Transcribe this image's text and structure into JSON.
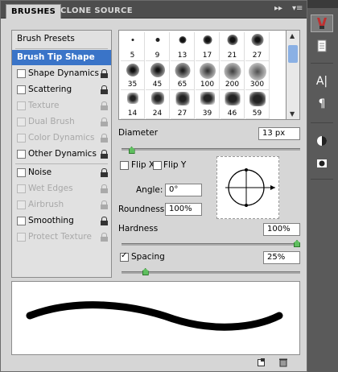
{
  "tabs": {
    "brushes": "BRUSHES",
    "clone_source": "CLONE SOURCE"
  },
  "tab_menu_glyph": "▸▸",
  "left_list": {
    "brush_presets": "Brush Presets",
    "brush_tip_shape": "Brush Tip Shape",
    "items": [
      {
        "label": "Shape Dynamics",
        "enabled": true
      },
      {
        "label": "Scattering",
        "enabled": true
      },
      {
        "label": "Texture",
        "enabled": false
      },
      {
        "label": "Dual Brush",
        "enabled": false
      },
      {
        "label": "Color Dynamics",
        "enabled": false
      },
      {
        "label": "Other Dynamics",
        "enabled": true
      },
      {
        "label": "Noise",
        "enabled": true
      },
      {
        "label": "Wet Edges",
        "enabled": false
      },
      {
        "label": "Airbrush",
        "enabled": false
      },
      {
        "label": "Smoothing",
        "enabled": true
      },
      {
        "label": "Protect Texture",
        "enabled": false
      }
    ]
  },
  "presets": {
    "row1": [
      "5",
      "9",
      "13",
      "17",
      "21",
      "27"
    ],
    "row2": [
      "35",
      "45",
      "65",
      "100",
      "200",
      "300"
    ],
    "row3": [
      "14",
      "24",
      "27",
      "39",
      "46",
      "59"
    ]
  },
  "diameter": {
    "label": "Diameter",
    "value": "13 px",
    "slider_fraction": 0.04
  },
  "flip": {
    "x_label": "Flip X",
    "y_label": "Flip Y"
  },
  "angle": {
    "label": "Angle:",
    "value": "0°"
  },
  "roundness": {
    "label": "Roundness:",
    "value": "100%"
  },
  "hardness": {
    "label": "Hardness",
    "value": "100%",
    "slider_fraction": 1.0
  },
  "spacing": {
    "label": "Spacing",
    "value": "25%",
    "slider_fraction": 0.12
  }
}
